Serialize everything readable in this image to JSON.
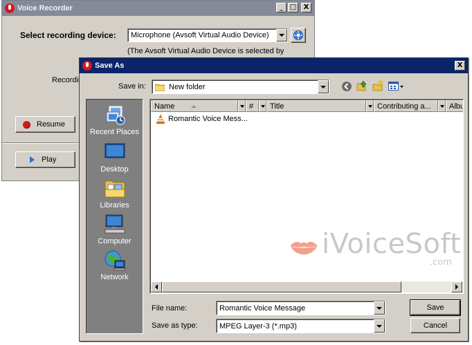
{
  "voice_recorder": {
    "title": "Voice Recorder",
    "device_label": "Select recording device:",
    "device_value": "Microphone (Avsoft Virtual Audio Device)",
    "device_note": "(The Avsoft Virtual Audio Device is selected by",
    "recording_label": "Recordin",
    "resume_label": "Resume",
    "play_label": "Play",
    "title_buttons": [
      "_",
      "□",
      "X"
    ]
  },
  "save_as": {
    "title": "Save As",
    "close_glyph": "X",
    "save_in_label": "Save in:",
    "save_in_value": "New folder",
    "places": [
      {
        "label": "Recent Places",
        "icon": "recent-places-icon"
      },
      {
        "label": "Desktop",
        "icon": "desktop-icon"
      },
      {
        "label": "Libraries",
        "icon": "libraries-icon"
      },
      {
        "label": "Computer",
        "icon": "computer-icon"
      },
      {
        "label": "Network",
        "icon": "network-icon"
      }
    ],
    "columns": [
      "Name",
      "#",
      "Title",
      "Contributing a...",
      "Album"
    ],
    "files": [
      {
        "name": "Romantic Voice Mess...",
        "icon": "vlc-file-icon"
      }
    ],
    "file_name_label": "File name:",
    "file_name_value": "Romantic Voice Message",
    "save_type_label": "Save as type:",
    "save_type_value": "MPEG Layer-3 (*.mp3)",
    "save_button": "Save",
    "cancel_button": "Cancel"
  },
  "watermark": {
    "brand": "iVoiceSoft",
    "suffix": ".com"
  },
  "colors": {
    "active_title": "#0a246a",
    "inactive_title": "#838b9b",
    "dialog_face": "#d4d0c8",
    "places_bg": "#808080",
    "resume_red": "#d81818",
    "play_blue": "#2f6fd6",
    "watermark_lips": "#f4a08e"
  }
}
